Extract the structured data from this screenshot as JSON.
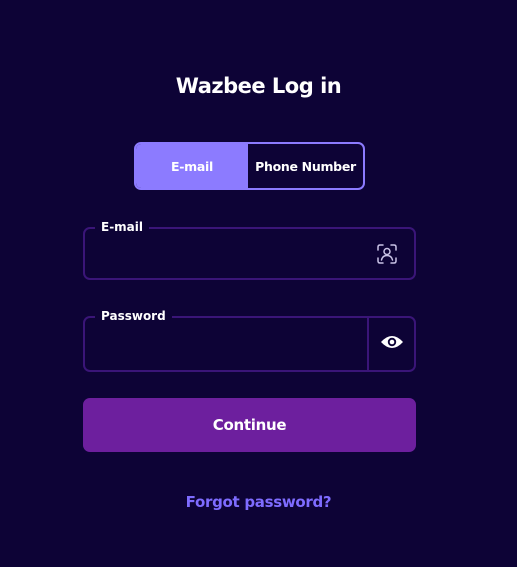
{
  "page": {
    "title": "Wazbee Log in"
  },
  "login_method_toggle": {
    "options": [
      {
        "label": "E-mail",
        "selected": true
      },
      {
        "label": "Phone Number",
        "selected": false
      }
    ]
  },
  "email_field": {
    "label": "E-mail",
    "value": "",
    "icon": "user-scan-icon"
  },
  "password_field": {
    "label": "Password",
    "value": "",
    "icon": "eye-icon"
  },
  "actions": {
    "continue_label": "Continue",
    "forgot_password_label": "Forgot password?"
  },
  "colors": {
    "background": "#0d0336",
    "accent": "#8c7bff",
    "field_border": "#3a1578",
    "primary_button": "#6d1f9e",
    "link": "#7e6cff"
  }
}
